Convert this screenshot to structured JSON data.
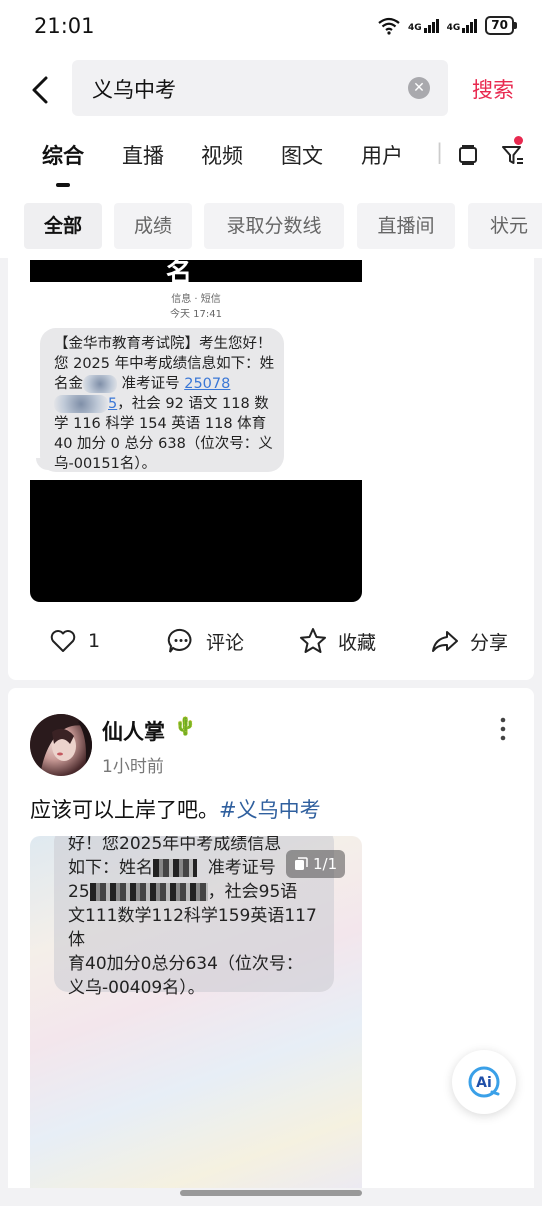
{
  "status_bar": {
    "time": "21:01",
    "network1": "4G",
    "network2": "4G",
    "battery": "70"
  },
  "search": {
    "query": "义乌中考",
    "submit_label": "搜索"
  },
  "tabs": [
    {
      "label": "综合",
      "active": true
    },
    {
      "label": "直播"
    },
    {
      "label": "视频"
    },
    {
      "label": "图文"
    },
    {
      "label": "用户"
    }
  ],
  "chips": [
    {
      "label": "全部",
      "active": true
    },
    {
      "label": "成绩"
    },
    {
      "label": "录取分数线"
    },
    {
      "label": "直播间"
    },
    {
      "label": "状元"
    }
  ],
  "post1": {
    "image": {
      "top_name": "名",
      "meta_line1": "信息 · 短信",
      "meta_line2": "今天 17:41",
      "sms_part1": "【金华市教育考试院】考生您好！您 2025 年中考成绩信息如下：姓名金",
      "sms_part2": "准考证号",
      "sms_link1": "25078",
      "sms_link2": "5",
      "sms_part3": "，社会 92 语文 118 数学 116 科学 154 英语 118 体育 40 加分 0 总分 638（位次号：义乌-00151名）。"
    },
    "actions": {
      "like_count": "1",
      "comment_label": "评论",
      "favorite_label": "收藏",
      "share_label": "分享"
    }
  },
  "post2": {
    "username": "仙人掌",
    "time": "1小时前",
    "text": "应该可以上岸了吧。",
    "hashtag": "#义乌中考",
    "page_indicator": "1/1",
    "image": {
      "line1": "好！您2025年中考成绩信息",
      "line2a": "如下：姓名",
      "line2b": "准考证号",
      "line3a": "25",
      "line3b": "，社会95语",
      "line4": "文111数学112科学159英语117体",
      "line5": "育40加分0总分634（位次号：",
      "line6": "义乌-00409名）。"
    }
  },
  "colors": {
    "accent": "#e8294f",
    "hashtag": "#2f5f9e",
    "link": "#3a77d6"
  },
  "ai_button": "Ai"
}
